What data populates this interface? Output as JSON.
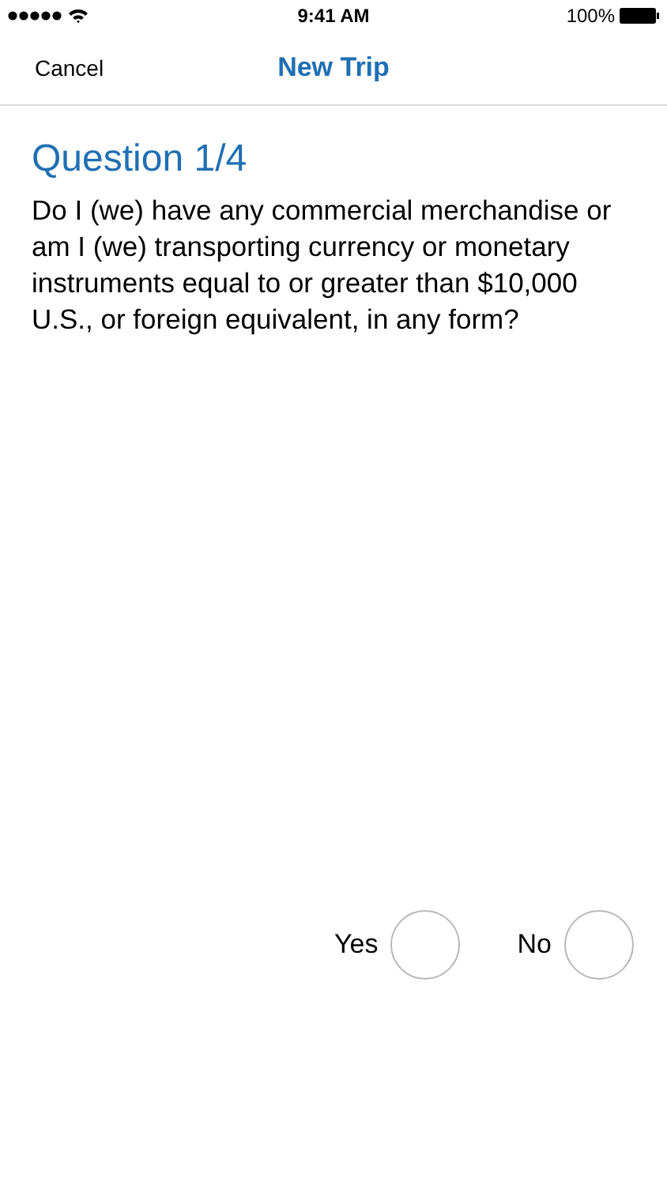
{
  "status_bar": {
    "time": "9:41 AM",
    "battery": "100%"
  },
  "nav_bar": {
    "cancel": "Cancel",
    "title": "New Trip"
  },
  "question": {
    "heading": "Question 1/4",
    "text": "Do I (we) have any commercial merchandise or am I (we) transporting currency or monetary instruments equal to or greater than $10,000 U.S., or foreign equivalent, in any form?"
  },
  "answers": [
    {
      "label": "Yes",
      "selected": false
    },
    {
      "label": "No",
      "selected": false
    }
  ]
}
